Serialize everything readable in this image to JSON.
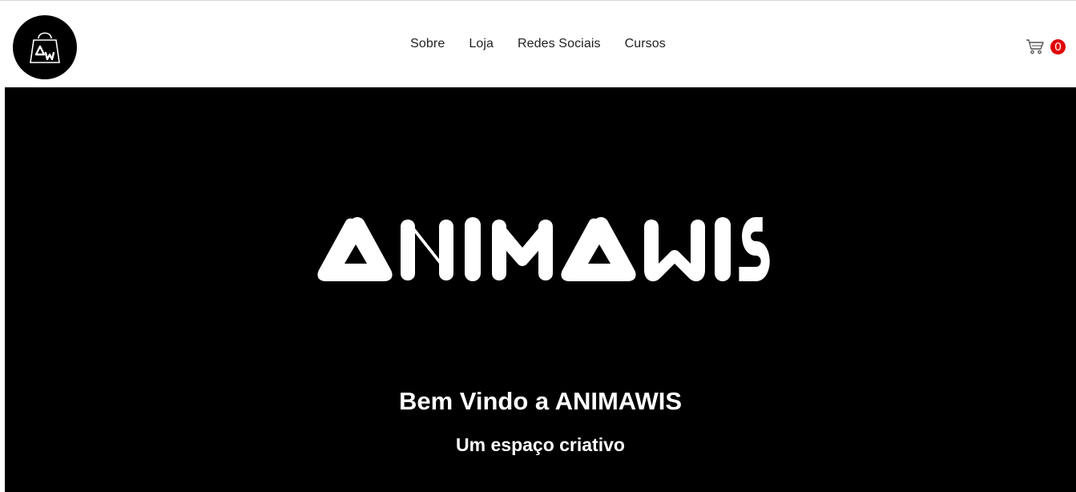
{
  "header": {
    "logo": {
      "icon": "shopping-bag-icon",
      "text": "ΔW"
    },
    "nav": {
      "items": [
        {
          "label": "Sobre"
        },
        {
          "label": "Loja"
        },
        {
          "label": "Redes Sociais"
        },
        {
          "label": "Cursos"
        }
      ]
    },
    "cart": {
      "icon": "cart-icon",
      "count": "0",
      "badge_color": "#e00000"
    }
  },
  "hero": {
    "brand_wordmark": "ANIMAWIS",
    "title": "Bem Vindo a ANIMAWIS",
    "subtitle": "Um espaço criativo",
    "background": "#000000",
    "text_color": "#ffffff"
  }
}
